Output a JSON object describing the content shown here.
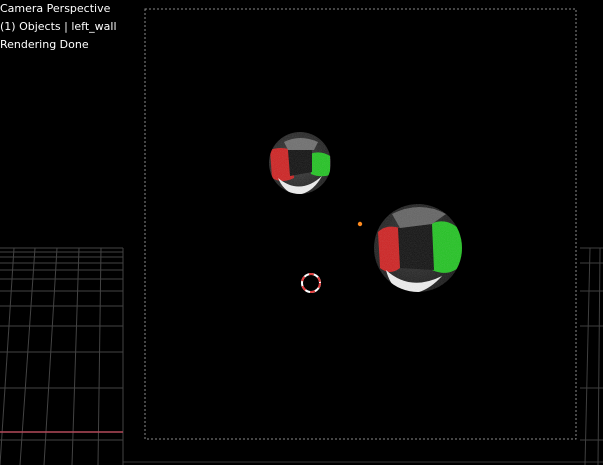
{
  "viewport": {
    "overlay": {
      "view_name": "Camera Perspective",
      "active_object": "(1) Objects | left_wall",
      "render_status": "Rendering Done"
    },
    "colors": {
      "background": "#000000",
      "grid_line": "#5a5a5a",
      "x_axis": "#b44a5b",
      "camera_border": "#8a8a8a",
      "cursor_red": "#e23b3b",
      "cursor_white": "#ffffff",
      "origin": "#ff8a1e",
      "reflection_red": "#d01818",
      "reflection_green": "#19c419",
      "reflection_white": "#f2f2f2"
    },
    "icons": [
      "3d-cursor-icon",
      "object-origin-icon"
    ]
  }
}
